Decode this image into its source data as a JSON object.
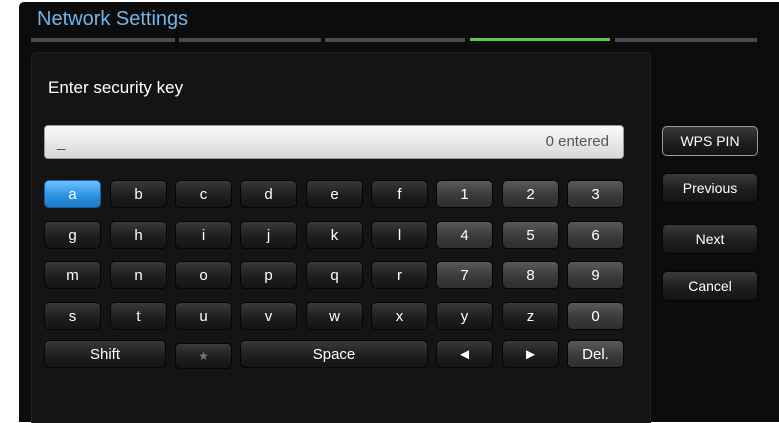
{
  "title": "Network Settings",
  "progress": {
    "steps": 5,
    "active_step": 4
  },
  "prompt": "Enter security key",
  "input": {
    "cursor": "_",
    "count": "0 entered"
  },
  "keys": {
    "r1": [
      "a",
      "b",
      "c",
      "d",
      "e",
      "f",
      "1",
      "2",
      "3"
    ],
    "r2": [
      "g",
      "h",
      "i",
      "j",
      "k",
      "l",
      "4",
      "5",
      "6"
    ],
    "r3": [
      "m",
      "n",
      "o",
      "p",
      "q",
      "r",
      "7",
      "8",
      "9"
    ],
    "r4": [
      "s",
      "t",
      "u",
      "v",
      "w",
      "x",
      "y",
      "z",
      "0"
    ],
    "shift": "Shift",
    "star": "★",
    "space": "Space",
    "left": "◄",
    "right": "►",
    "del": "Del."
  },
  "side": {
    "wps": "WPS PIN",
    "previous": "Previous",
    "next": "Next",
    "cancel": "Cancel"
  },
  "colors": {
    "title": "#6fb6ee",
    "active_step": "#5fc84a",
    "selected_key": "#2a8fe0"
  }
}
